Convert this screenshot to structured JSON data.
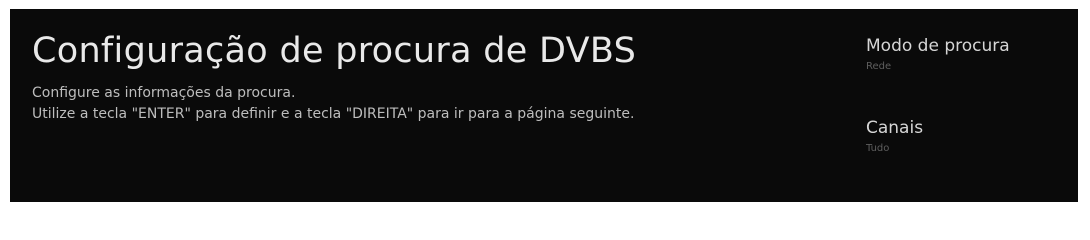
{
  "header": {
    "title": "Configuração de procura de DVBS",
    "description_line1": "Configure as informações da procura.",
    "description_line2": "Utilize a tecla \"ENTER\" para definir e a tecla \"DIREITA\" para ir para a página seguinte."
  },
  "settings": {
    "items": [
      {
        "label": "Modo de procura",
        "value": "Rede"
      },
      {
        "label": "Canais",
        "value": "Tudo"
      }
    ]
  },
  "colors": {
    "background": "#0a0a0a",
    "title": "#e9e9e9",
    "description": "#bdbdbd",
    "setting_label": "#d6d6d6",
    "setting_value": "#5e5e5e"
  }
}
